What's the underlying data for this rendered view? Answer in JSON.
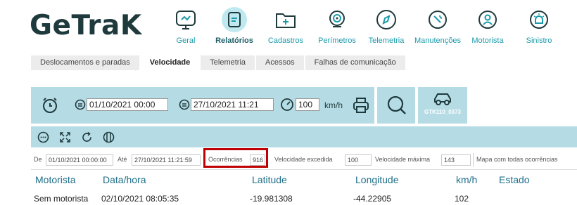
{
  "logo": {
    "text": "GeTraK"
  },
  "nav": {
    "items": [
      {
        "label": "Geral",
        "icon": "monitor-chart-icon"
      },
      {
        "label": "Relatórios",
        "icon": "report-icon"
      },
      {
        "label": "Cadastros",
        "icon": "folder-plus-icon"
      },
      {
        "label": "Perímetros",
        "icon": "map-pin-icon"
      },
      {
        "label": "Telemetria",
        "icon": "compass-icon"
      },
      {
        "label": "Manutenções",
        "icon": "wrench-icon"
      },
      {
        "label": "Motorista",
        "icon": "driver-icon"
      },
      {
        "label": "Sinistro",
        "icon": "alarm-icon"
      }
    ],
    "active": "Relatórios"
  },
  "tabs": {
    "items": [
      "Deslocamentos e paradas",
      "Velocidade",
      "Telemetria",
      "Acessos",
      "Falhas de comunicação"
    ],
    "active": "Velocidade"
  },
  "params": {
    "start_datetime": "01/10/2021 00:00",
    "end_datetime": "27/10/2021 11:21",
    "speed": "100",
    "speed_unit": "km/h"
  },
  "vehicle": {
    "plate": "GTK110_0373"
  },
  "filter": {
    "de_label": "De",
    "de_value": "01/10/2021 00:00:00",
    "ate_label": "Até",
    "ate_value": "27/10/2021 11:21:59",
    "ocorrencias_label": "Ocorrências",
    "ocorrencias_value": "916",
    "vel_excedida_label": "Velocidade excedida",
    "vel_excedida_value": "100",
    "vel_maxima_label": "Velocidade máxima",
    "vel_maxima_value": "143",
    "mapa_label": "Mapa com todas ocorrências"
  },
  "table": {
    "headers": [
      "Motorista",
      "Data/hora",
      "Latitude",
      "Longitude",
      "km/h",
      "Estado"
    ],
    "rows": [
      [
        "Sem motorista",
        "02/10/2021 08:05:35",
        "-19.981308",
        "-44.22905",
        "102",
        ""
      ]
    ]
  },
  "colors": {
    "accent": "#1a9aaa",
    "panel": "#b5dce4",
    "highlight": "#c00000",
    "dark": "#1f3a3d"
  }
}
